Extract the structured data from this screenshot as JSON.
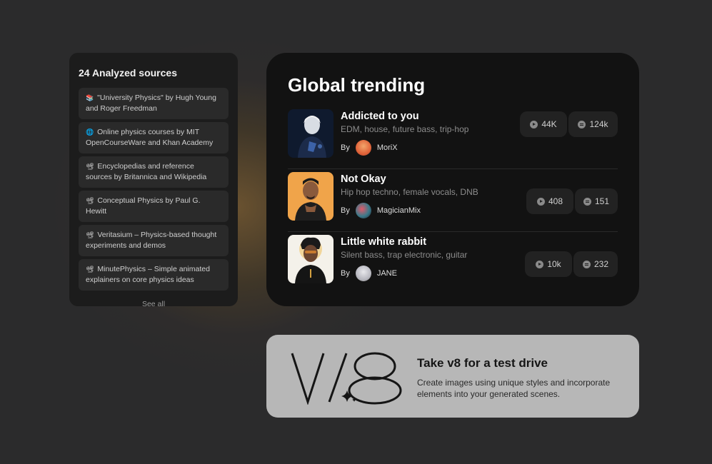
{
  "sources": {
    "title": "24 Analyzed sources",
    "items": [
      {
        "icon": "📚",
        "text": "\"University Physics\" by Hugh Young and Roger Freedman"
      },
      {
        "icon": "🌐",
        "text": "Online physics courses by MIT OpenCourseWare and Khan Academy"
      },
      {
        "icon": "📽",
        "text": "Encyclopedias and reference sources by Britannica and Wikipedia"
      },
      {
        "icon": "📽",
        "text": "Conceptual Physics by Paul G. Hewitt"
      },
      {
        "icon": "📽",
        "text": "Veritasium – Physics-based thought experiments and demos"
      },
      {
        "icon": "📽",
        "text": "MinutePhysics – Simple animated explainers on core physics ideas"
      }
    ],
    "see_all": "See all"
  },
  "trending": {
    "title": "Global trending",
    "by_label": "By",
    "tracks": [
      {
        "title": "Addicted to you",
        "tags": "EDM, house, future bass, trip-hop",
        "author": "MoriX",
        "plays": "44K",
        "comments": "124k"
      },
      {
        "title": "Not Okay",
        "tags": "Hip hop techno, female vocals, DNB",
        "author": "MagicianMix",
        "plays": "408",
        "comments": "151"
      },
      {
        "title": "Little white rabbit",
        "tags": "Silent bass, trap electronic, guitar",
        "author": "JANE",
        "plays": "10k",
        "comments": "232"
      }
    ]
  },
  "promo": {
    "title": "Take v8 for a test drive",
    "description": "Create images using unique styles and incorporate elements into your generated scenes.",
    "logo_text": "V8"
  },
  "icons": {
    "play": "play-icon",
    "comment": "comment-icon",
    "sparkle": "sparkle-icon"
  }
}
